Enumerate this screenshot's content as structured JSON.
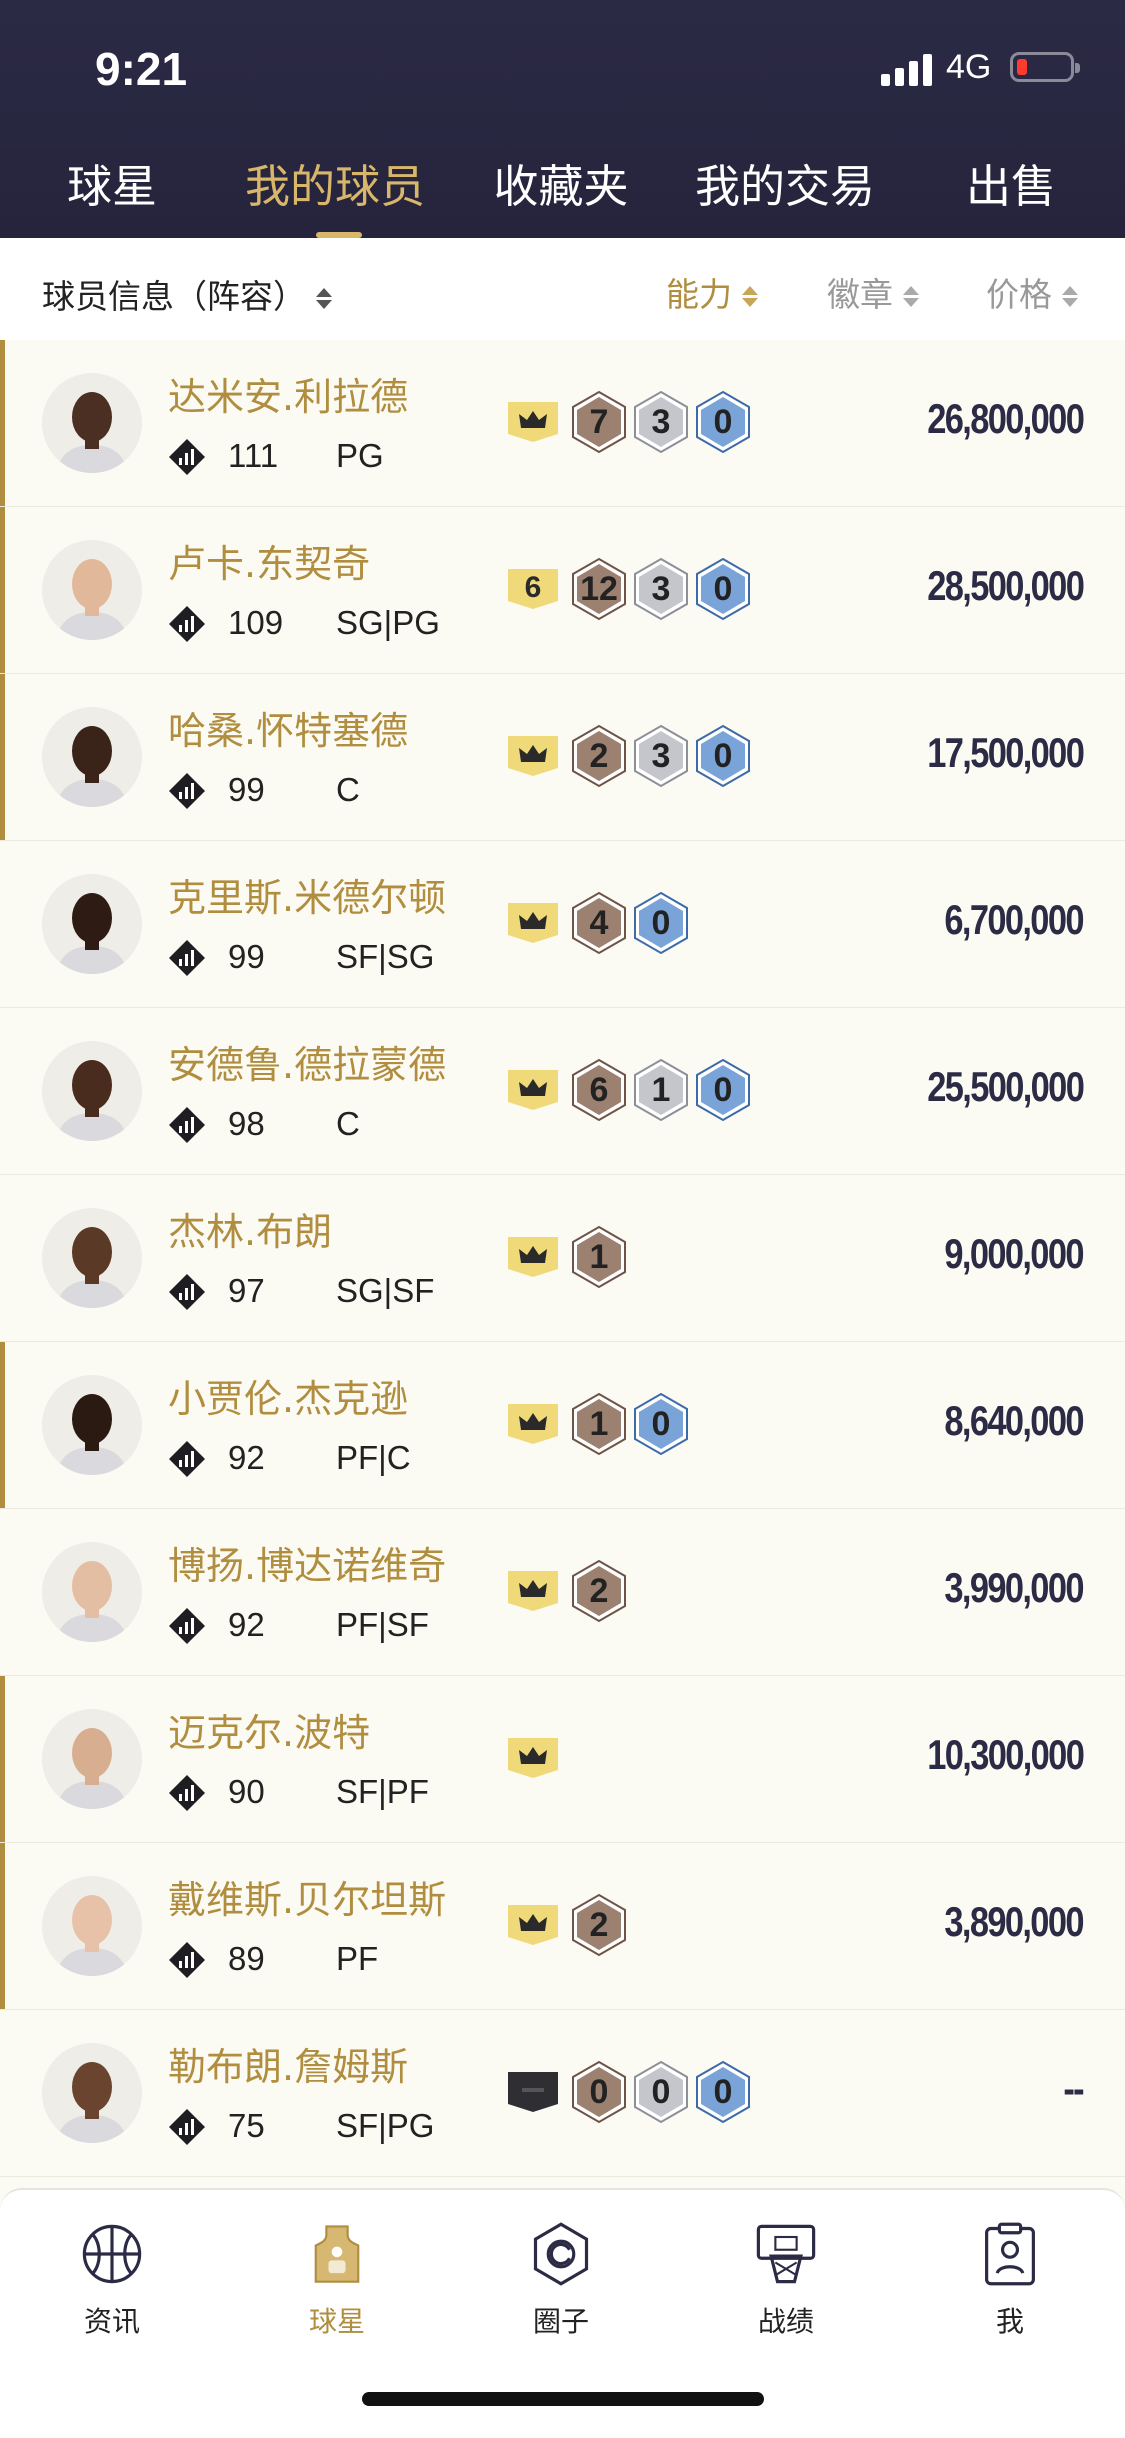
{
  "status": {
    "time": "9:21",
    "network": "4G"
  },
  "tabs": [
    {
      "label": "球星"
    },
    {
      "label": "我的球员"
    },
    {
      "label": "收藏夹"
    },
    {
      "label": "我的交易"
    },
    {
      "label": "出售"
    }
  ],
  "active_tab": "我的球员",
  "filter": {
    "lineup_label": "球员信息（阵容）",
    "sort_ability": "能力",
    "sort_badge": "徽章",
    "sort_price": "价格"
  },
  "players": [
    {
      "name": "达米安.利拉德",
      "ovr": "111",
      "pos": "PG",
      "crown": "crown",
      "badges": [
        "7",
        "3",
        "0"
      ],
      "badge_types": [
        "bronze",
        "silver",
        "blue"
      ],
      "price": "26,800,000"
    },
    {
      "name": "卢卡.东契奇",
      "ovr": "109",
      "pos": "SG|PG",
      "crown": "6",
      "badges": [
        "12",
        "3",
        "0"
      ],
      "badge_types": [
        "bronze",
        "silver",
        "blue"
      ],
      "price": "28,500,000"
    },
    {
      "name": "哈桑.怀特塞德",
      "ovr": "99",
      "pos": "C",
      "crown": "crown",
      "badges": [
        "2",
        "3",
        "0"
      ],
      "badge_types": [
        "bronze",
        "silver",
        "blue"
      ],
      "price": "17,500,000"
    },
    {
      "name": "克里斯.米德尔顿",
      "ovr": "99",
      "pos": "SF|SG",
      "crown": "crown",
      "badges": [
        "4",
        "0"
      ],
      "badge_types": [
        "bronze",
        "blue"
      ],
      "price": "6,700,000"
    },
    {
      "name": "安德鲁.德拉蒙德",
      "ovr": "98",
      "pos": "C",
      "crown": "crown",
      "badges": [
        "6",
        "1",
        "0"
      ],
      "badge_types": [
        "bronze",
        "silver",
        "blue"
      ],
      "price": "25,500,000"
    },
    {
      "name": "杰林.布朗",
      "ovr": "97",
      "pos": "SG|SF",
      "crown": "crown",
      "badges": [
        "1"
      ],
      "badge_types": [
        "bronze"
      ],
      "price": "9,000,000"
    },
    {
      "name": "小贾伦.杰克逊",
      "ovr": "92",
      "pos": "PF|C",
      "crown": "crown",
      "badges": [
        "1",
        "0"
      ],
      "badge_types": [
        "bronze",
        "blue"
      ],
      "price": "8,640,000"
    },
    {
      "name": "博扬.博达诺维奇",
      "ovr": "92",
      "pos": "PF|SF",
      "crown": "crown",
      "badges": [
        "2"
      ],
      "badge_types": [
        "bronze"
      ],
      "price": "3,990,000"
    },
    {
      "name": "迈克尔.波特",
      "ovr": "90",
      "pos": "SF|PF",
      "crown": "crown",
      "badges": [],
      "badge_types": [],
      "price": "10,300,000"
    },
    {
      "name": "戴维斯.贝尔坦斯",
      "ovr": "89",
      "pos": "PF",
      "crown": "crown",
      "badges": [
        "2"
      ],
      "badge_types": [
        "bronze"
      ],
      "price": "3,890,000"
    },
    {
      "name": "勒布朗.詹姆斯",
      "ovr": "75",
      "pos": "SF|PG",
      "crown": "dark",
      "badges": [
        "0",
        "0",
        "0"
      ],
      "badge_types": [
        "bronze",
        "silver",
        "blue"
      ],
      "price": "--"
    }
  ],
  "bottom_nav": [
    {
      "label": "资讯",
      "icon": "basketball-icon"
    },
    {
      "label": "球星",
      "icon": "jersey-icon"
    },
    {
      "label": "圈子",
      "icon": "circle-hex-icon"
    },
    {
      "label": "战绩",
      "icon": "hoop-icon"
    },
    {
      "label": "我",
      "icon": "profile-clipboard-icon"
    }
  ],
  "colors": {
    "gold": "#b08d3f",
    "header_bg": "#2b2a45",
    "bronze": "#8e7466",
    "silver": "#a8aab3",
    "blue": "#5b86c0"
  }
}
